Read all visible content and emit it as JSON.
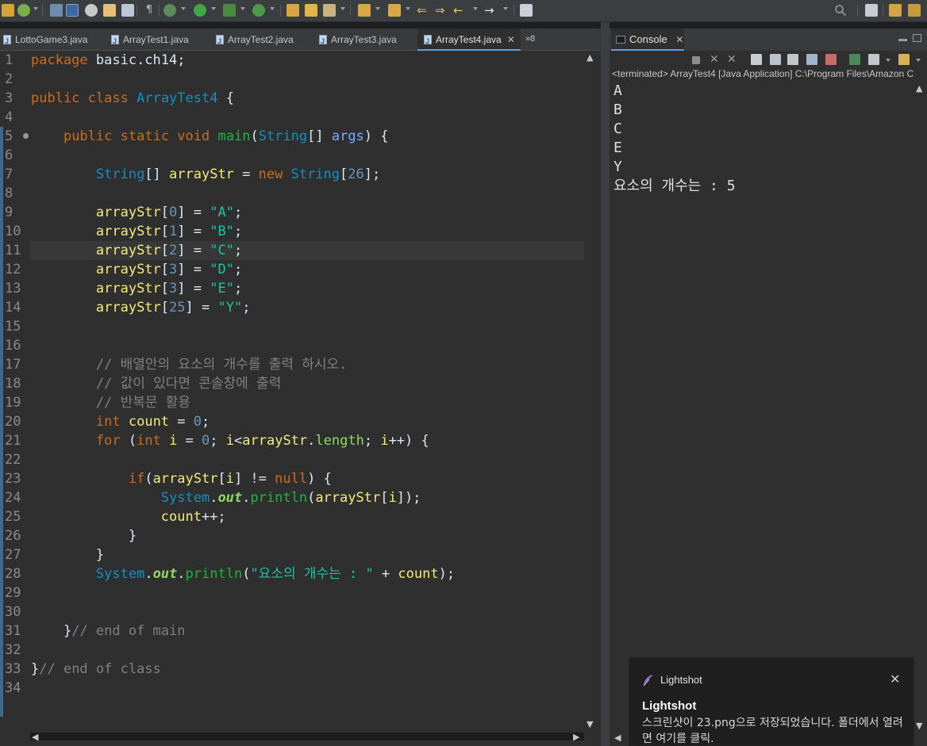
{
  "editor": {
    "tabs": [
      {
        "label": "LottoGame3.java"
      },
      {
        "label": "ArrayTest1.java"
      },
      {
        "label": "ArrayTest2.java"
      },
      {
        "label": "ArrayTest3.java"
      },
      {
        "label": "ArrayTest4.java",
        "active": true
      }
    ],
    "more_tabs": "»8",
    "close_glyph": "✕",
    "line_numbers": [
      "1",
      "2",
      "3",
      "4",
      "5",
      "6",
      "7",
      "8",
      "9",
      "10",
      "11",
      "12",
      "13",
      "14",
      "15",
      "16",
      "17",
      "18",
      "19",
      "20",
      "21",
      "22",
      "23",
      "24",
      "25",
      "26",
      "27",
      "28",
      "29",
      "30",
      "31",
      "32",
      "33",
      "34"
    ],
    "current_line": 11,
    "code": [
      [
        [
          "kw",
          "package"
        ],
        [
          "plain",
          " basic.ch14;"
        ]
      ],
      [],
      [
        [
          "kw",
          "public"
        ],
        [
          "plain",
          " "
        ],
        [
          "kw",
          "class"
        ],
        [
          "plain",
          " "
        ],
        [
          "ty",
          "ArrayTest4"
        ],
        [
          "plain",
          " {"
        ]
      ],
      [],
      [
        [
          "plain",
          "    "
        ],
        [
          "kw",
          "public"
        ],
        [
          "plain",
          " "
        ],
        [
          "kw",
          "static"
        ],
        [
          "plain",
          " "
        ],
        [
          "kw",
          "void"
        ],
        [
          "plain",
          " "
        ],
        [
          "fn",
          "main"
        ],
        [
          "plain",
          "("
        ],
        [
          "ty",
          "String"
        ],
        [
          "plain",
          "[] "
        ],
        [
          "param",
          "args"
        ],
        [
          "plain",
          ") {"
        ]
      ],
      [],
      [
        [
          "plain",
          "        "
        ],
        [
          "ty",
          "String"
        ],
        [
          "plain",
          "[] "
        ],
        [
          "var",
          "arrayStr"
        ],
        [
          "plain",
          " = "
        ],
        [
          "kw",
          "new"
        ],
        [
          "plain",
          " "
        ],
        [
          "ty",
          "String"
        ],
        [
          "plain",
          "["
        ],
        [
          "num",
          "26"
        ],
        [
          "plain",
          "];"
        ]
      ],
      [],
      [
        [
          "plain",
          "        "
        ],
        [
          "var",
          "arrayStr"
        ],
        [
          "plain",
          "["
        ],
        [
          "num",
          "0"
        ],
        [
          "plain",
          "] = "
        ],
        [
          "str",
          "\"A\""
        ],
        [
          "plain",
          ";"
        ]
      ],
      [
        [
          "plain",
          "        "
        ],
        [
          "var",
          "arrayStr"
        ],
        [
          "plain",
          "["
        ],
        [
          "num",
          "1"
        ],
        [
          "plain",
          "] = "
        ],
        [
          "str",
          "\"B\""
        ],
        [
          "plain",
          ";"
        ]
      ],
      [
        [
          "plain",
          "        "
        ],
        [
          "var",
          "arrayStr"
        ],
        [
          "plain",
          "["
        ],
        [
          "num",
          "2"
        ],
        [
          "plain",
          "] = "
        ],
        [
          "str",
          "\"C\""
        ],
        [
          "plain",
          ";"
        ]
      ],
      [
        [
          "plain",
          "        "
        ],
        [
          "var",
          "arrayStr"
        ],
        [
          "plain",
          "["
        ],
        [
          "num",
          "3"
        ],
        [
          "plain",
          "] = "
        ],
        [
          "str",
          "\"D\""
        ],
        [
          "plain",
          ";"
        ]
      ],
      [
        [
          "plain",
          "        "
        ],
        [
          "var",
          "arrayStr"
        ],
        [
          "plain",
          "["
        ],
        [
          "num",
          "3"
        ],
        [
          "plain",
          "] = "
        ],
        [
          "str",
          "\"E\""
        ],
        [
          "plain",
          ";"
        ]
      ],
      [
        [
          "plain",
          "        "
        ],
        [
          "var",
          "arrayStr"
        ],
        [
          "plain",
          "["
        ],
        [
          "num",
          "25"
        ],
        [
          "plain",
          "] = "
        ],
        [
          "str",
          "\"Y\""
        ],
        [
          "plain",
          ";"
        ]
      ],
      [],
      [],
      [
        [
          "plain",
          "        "
        ],
        [
          "cm",
          "// 배열안의 요소의 개수를 출력 하시오."
        ]
      ],
      [
        [
          "plain",
          "        "
        ],
        [
          "cm",
          "// 값이 있다면 콘솔창에 출력"
        ]
      ],
      [
        [
          "plain",
          "        "
        ],
        [
          "cm",
          "// 반복문 활용"
        ]
      ],
      [
        [
          "plain",
          "        "
        ],
        [
          "kw",
          "int"
        ],
        [
          "plain",
          " "
        ],
        [
          "var",
          "count"
        ],
        [
          "plain",
          " = "
        ],
        [
          "num",
          "0"
        ],
        [
          "plain",
          ";"
        ]
      ],
      [
        [
          "plain",
          "        "
        ],
        [
          "kw",
          "for"
        ],
        [
          "plain",
          " ("
        ],
        [
          "kw",
          "int"
        ],
        [
          "plain",
          " "
        ],
        [
          "var",
          "i"
        ],
        [
          "plain",
          " = "
        ],
        [
          "num",
          "0"
        ],
        [
          "plain",
          "; "
        ],
        [
          "var",
          "i"
        ],
        [
          "plain",
          "<"
        ],
        [
          "var",
          "arrayStr"
        ],
        [
          "plain",
          "."
        ],
        [
          "fld",
          "length"
        ],
        [
          "plain",
          "; "
        ],
        [
          "var",
          "i"
        ],
        [
          "plain",
          "++) {"
        ]
      ],
      [],
      [
        [
          "plain",
          "            "
        ],
        [
          "kw",
          "if"
        ],
        [
          "plain",
          "("
        ],
        [
          "var",
          "arrayStr"
        ],
        [
          "plain",
          "["
        ],
        [
          "var",
          "i"
        ],
        [
          "plain",
          "] != "
        ],
        [
          "kw",
          "null"
        ],
        [
          "plain",
          ") {"
        ]
      ],
      [
        [
          "plain",
          "                "
        ],
        [
          "ty",
          "System"
        ],
        [
          "plain",
          "."
        ],
        [
          "static",
          "out"
        ],
        [
          "plain",
          "."
        ],
        [
          "fn",
          "println"
        ],
        [
          "plain",
          "("
        ],
        [
          "var",
          "arrayStr"
        ],
        [
          "plain",
          "["
        ],
        [
          "var",
          "i"
        ],
        [
          "plain",
          "]);"
        ]
      ],
      [
        [
          "plain",
          "                "
        ],
        [
          "var",
          "count"
        ],
        [
          "plain",
          "++;"
        ]
      ],
      [
        [
          "plain",
          "            }"
        ]
      ],
      [
        [
          "plain",
          "        }"
        ]
      ],
      [
        [
          "plain",
          "        "
        ],
        [
          "ty",
          "System"
        ],
        [
          "plain",
          "."
        ],
        [
          "static",
          "out"
        ],
        [
          "plain",
          "."
        ],
        [
          "fn",
          "println"
        ],
        [
          "plain",
          "("
        ],
        [
          "str",
          "\"요소의 개수는 : \""
        ],
        [
          "plain",
          " + "
        ],
        [
          "var",
          "count"
        ],
        [
          "plain",
          ");"
        ]
      ],
      [],
      [],
      [
        [
          "plain",
          "    }"
        ],
        [
          "cm",
          "// end of main"
        ]
      ],
      [],
      [
        [
          "plain",
          "}"
        ],
        [
          "cm",
          "// end of class"
        ]
      ],
      []
    ]
  },
  "console": {
    "tab_label": "Console",
    "close_glyph": "✕",
    "status": "<terminated> ArrayTest4 [Java Application] C:\\Program Files\\Amazon C",
    "output": [
      "A",
      "B",
      "C",
      "E",
      "Y",
      "요소의 개수는 : 5"
    ]
  },
  "toast": {
    "app_name": "Lightshot",
    "title": "Lightshot",
    "body": "스크린샷이 23.png으로 저장되었습니다. 폴더에서 열려면 여기를 클릭.",
    "close_glyph": "✕"
  },
  "scroll": {
    "up": "▲",
    "down": "▼",
    "left": "◀",
    "right": "▶"
  },
  "colors": {
    "keyword": "#cc6c1d",
    "type": "#1290c3",
    "string": "#17c6a3",
    "comment": "#808080",
    "variable": "#f3ec79",
    "background": "#2f2f2f"
  }
}
